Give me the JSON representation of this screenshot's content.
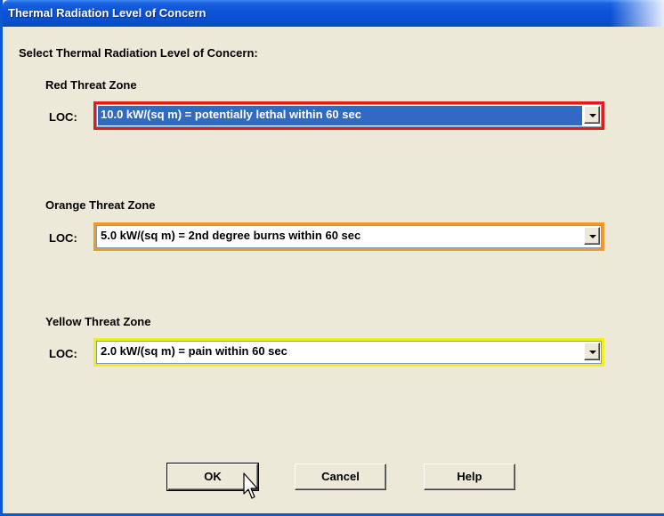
{
  "window": {
    "title": "Thermal Radiation Level of Concern"
  },
  "dialog": {
    "heading": "Select Thermal Radiation Level of Concern:",
    "zones": [
      {
        "label": "Red Threat Zone",
        "loc_label": "LOC:",
        "selected_value": "10.0 kW/(sq m) = potentially lethal within 60 sec",
        "border_color": "#e31b1b"
      },
      {
        "label": "Orange Threat Zone",
        "loc_label": "LOC:",
        "selected_value": "5.0 kW/(sq m) = 2nd degree burns within 60 sec",
        "border_color": "#f29a26"
      },
      {
        "label": "Yellow Threat Zone",
        "loc_label": "LOC:",
        "selected_value": "2.0 kW/(sq m) = pain within 60 sec",
        "border_color": "#f2ef1d"
      }
    ],
    "buttons": {
      "ok": "OK",
      "cancel": "Cancel",
      "help": "Help"
    }
  },
  "icons": {
    "dropdown": "chevron-down-icon",
    "cursor": "mouse-pointer-icon"
  },
  "colors": {
    "title_bar": "#0a53d8",
    "dialog_bg": "#ece9d8",
    "selection": "#316ac5"
  }
}
